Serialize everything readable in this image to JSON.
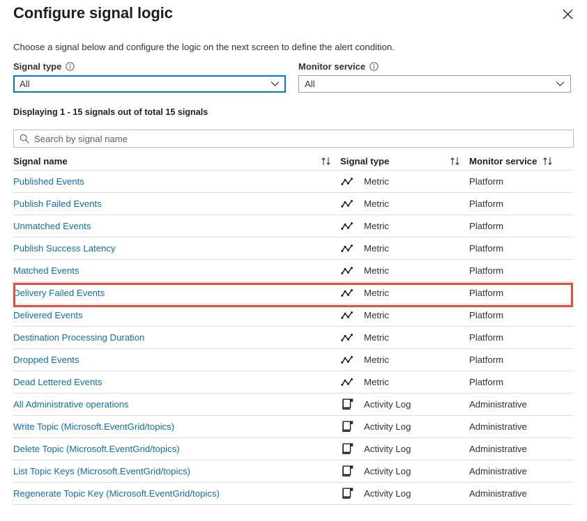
{
  "header": {
    "title": "Configure signal logic",
    "close_label": "Close"
  },
  "description": "Choose a signal below and configure the logic on the next screen to define the alert condition.",
  "filters": {
    "signal_type": {
      "label": "Signal type",
      "value": "All",
      "info_icon": "info-icon"
    },
    "monitor_service": {
      "label": "Monitor service",
      "value": "All",
      "info_icon": "info-icon"
    }
  },
  "count_text": "Displaying 1 - 15 signals out of total 15 signals",
  "search": {
    "placeholder": "Search by signal name",
    "value": "",
    "icon": "search-icon"
  },
  "table": {
    "columns": [
      {
        "label": "Signal name",
        "sort_icon": "sort-updown-icon"
      },
      {
        "label": "Signal type",
        "sort_icon": "sort-updown-icon"
      },
      {
        "label": "Monitor service",
        "sort_icon": "sort-updown-icon"
      }
    ],
    "rows": [
      {
        "name": "Published Events",
        "type": "Metric",
        "type_icon": "metric-icon",
        "monitor": "Platform",
        "highlighted": false
      },
      {
        "name": "Publish Failed Events",
        "type": "Metric",
        "type_icon": "metric-icon",
        "monitor": "Platform",
        "highlighted": false
      },
      {
        "name": "Unmatched Events",
        "type": "Metric",
        "type_icon": "metric-icon",
        "monitor": "Platform",
        "highlighted": false
      },
      {
        "name": "Publish Success Latency",
        "type": "Metric",
        "type_icon": "metric-icon",
        "monitor": "Platform",
        "highlighted": false
      },
      {
        "name": "Matched Events",
        "type": "Metric",
        "type_icon": "metric-icon",
        "monitor": "Platform",
        "highlighted": false
      },
      {
        "name": "Delivery Failed Events",
        "type": "Metric",
        "type_icon": "metric-icon",
        "monitor": "Platform",
        "highlighted": true
      },
      {
        "name": "Delivered Events",
        "type": "Metric",
        "type_icon": "metric-icon",
        "monitor": "Platform",
        "highlighted": false
      },
      {
        "name": "Destination Processing Duration",
        "type": "Metric",
        "type_icon": "metric-icon",
        "monitor": "Platform",
        "highlighted": false
      },
      {
        "name": "Dropped Events",
        "type": "Metric",
        "type_icon": "metric-icon",
        "monitor": "Platform",
        "highlighted": false
      },
      {
        "name": "Dead Lettered Events",
        "type": "Metric",
        "type_icon": "metric-icon",
        "monitor": "Platform",
        "highlighted": false
      },
      {
        "name": "All Administrative operations",
        "type": "Activity Log",
        "type_icon": "activity-log-icon",
        "monitor": "Administrative",
        "highlighted": false
      },
      {
        "name": "Write Topic (Microsoft.EventGrid/topics)",
        "type": "Activity Log",
        "type_icon": "activity-log-icon",
        "monitor": "Administrative",
        "highlighted": false
      },
      {
        "name": "Delete Topic (Microsoft.EventGrid/topics)",
        "type": "Activity Log",
        "type_icon": "activity-log-icon",
        "monitor": "Administrative",
        "highlighted": false
      },
      {
        "name": "List Topic Keys (Microsoft.EventGrid/topics)",
        "type": "Activity Log",
        "type_icon": "activity-log-icon",
        "monitor": "Administrative",
        "highlighted": false
      },
      {
        "name": "Regenerate Topic Key (Microsoft.EventGrid/topics)",
        "type": "Activity Log",
        "type_icon": "activity-log-icon",
        "monitor": "Administrative",
        "highlighted": false
      }
    ]
  },
  "colors": {
    "link": "#0f6cbd",
    "accent": "#0078d4",
    "highlight": "#e74c3c",
    "text": "#323130",
    "border": "#e1dfdd"
  }
}
